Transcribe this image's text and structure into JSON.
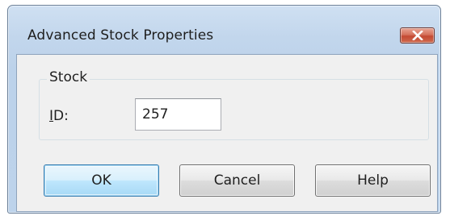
{
  "window": {
    "title": "Advanced Stock Properties",
    "close_icon": "close-x-icon"
  },
  "group": {
    "label": "Stock",
    "id_label_accel": "I",
    "id_label_rest": "D:",
    "id_value": "257"
  },
  "buttons": {
    "ok": "OK",
    "cancel": "Cancel",
    "help": "Help"
  },
  "colors": {
    "title_bar": "#c2d6ec",
    "close_button": "#c44a33",
    "default_button_border": "#3c7fb1",
    "client_background": "#f0f0f0"
  }
}
